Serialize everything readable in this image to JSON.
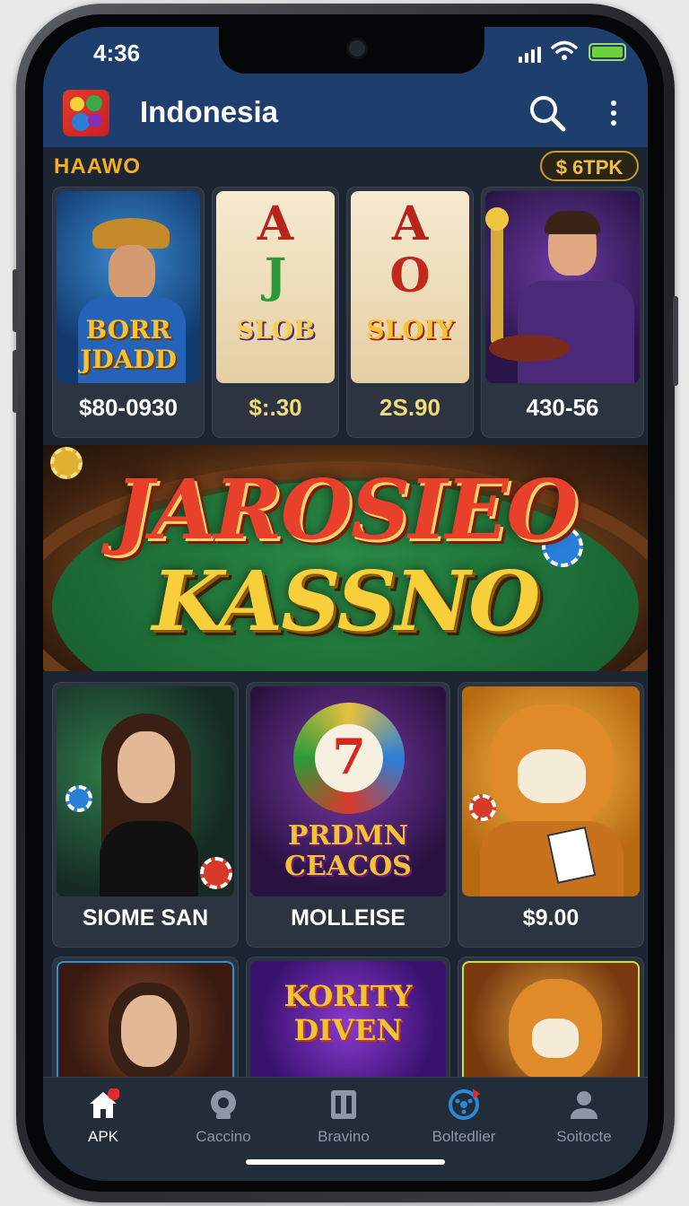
{
  "status_bar": {
    "time": "4:36"
  },
  "app_bar": {
    "title": "Indonesia"
  },
  "section": {
    "title": "HAAWO",
    "balance": "$ 6TPK"
  },
  "top_games": [
    {
      "art_text": "BORR JDADD",
      "caption": "$80-0930"
    },
    {
      "art_text": "SLOB",
      "caption": "$:.30",
      "reel": [
        "A",
        "J"
      ]
    },
    {
      "art_text": "SLOIY",
      "caption": "2S.90",
      "reel": [
        "A",
        "O"
      ]
    },
    {
      "art_text": "",
      "caption": "430-56"
    }
  ],
  "banner": {
    "line1": "JAROSIEO",
    "line2": "KASSNO"
  },
  "mid_games": [
    {
      "art_text": "",
      "caption": "SIOME SAN"
    },
    {
      "art_text": "PRDMN CEACOS",
      "caption": "MOLLEISE",
      "badge": "7"
    },
    {
      "art_text": "",
      "caption": "$9.00"
    }
  ],
  "bottom_games": [
    {
      "art_text": ""
    },
    {
      "art_text": "KORITY DIVEN"
    },
    {
      "art_text": ""
    }
  ],
  "nav": [
    {
      "label": "APK",
      "icon": "home-icon",
      "active": true
    },
    {
      "label": "Caccino",
      "icon": "chip-icon",
      "active": false
    },
    {
      "label": "Bravino",
      "icon": "slot-icon",
      "active": false
    },
    {
      "label": "Boltedlier",
      "icon": "roulette-icon",
      "active": false
    },
    {
      "label": "Soitocte",
      "icon": "profile-icon",
      "active": false
    }
  ],
  "colors": {
    "app_bar": "#1e3f6e",
    "accent_gold": "#f2b020",
    "background": "#1b2430"
  }
}
